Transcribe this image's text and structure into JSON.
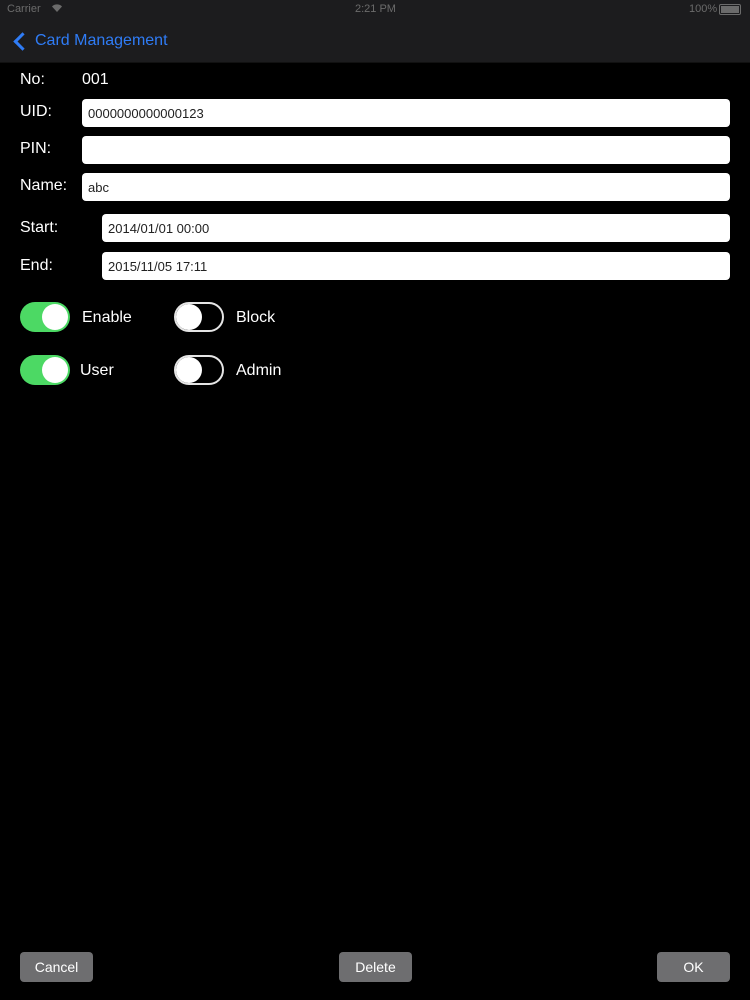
{
  "status_bar": {
    "carrier": "Carrier",
    "time": "2:21 PM",
    "battery": "100%"
  },
  "nav": {
    "back_label": "Card Management"
  },
  "form": {
    "no_label": "No:",
    "no_value": "001",
    "uid_label": "UID:",
    "uid_value": "0000000000000123",
    "pin_label": "PIN:",
    "pin_value": "",
    "name_label": "Name:",
    "name_value": "abc",
    "start_label": "Start:",
    "start_value": "2014/01/01 00:00",
    "end_label": "End:",
    "end_value": "2015/11/05 17:11"
  },
  "toggles": {
    "enable": {
      "label": "Enable",
      "on": true
    },
    "block": {
      "label": "Block",
      "on": false
    },
    "user": {
      "label": "User",
      "on": true
    },
    "admin": {
      "label": "Admin",
      "on": false
    }
  },
  "buttons": {
    "cancel": "Cancel",
    "delete": "Delete",
    "ok": "OK"
  },
  "colors": {
    "accent": "#2f7cf6",
    "toggle_on": "#4cd964",
    "button_bg": "#6e6e70"
  }
}
